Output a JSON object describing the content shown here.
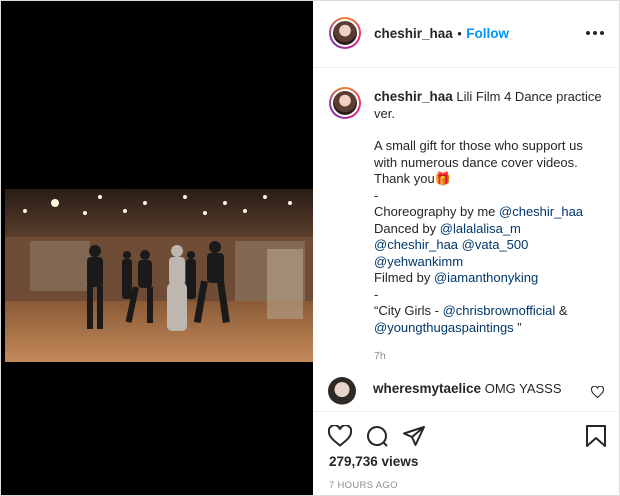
{
  "header": {
    "username": "cheshir_haa",
    "separator": "•",
    "follow_label": "Follow",
    "more_label": "•••"
  },
  "caption": {
    "username": "cheshir_haa",
    "title_line1": "Lili Film 4 Dance practice",
    "title_line2": "ver.",
    "p1_line1": "A small gift for those who support us",
    "p1_line2": "with numerous dance cover videos.",
    "p1_line3": "Thank you",
    "gift_emoji": "🎁",
    "dash1": "-",
    "choreo_prefix": "Choreography by me ",
    "choreo_link": "@cheshir_haa",
    "danced_prefix": "Danced by ",
    "danced_link1": "@lalalalisa_m",
    "danced_link2": "@cheshir_haa",
    "danced_link3": "@vata_500",
    "danced_link4": "@yehwankimm",
    "filmed_prefix": "Filmed by ",
    "filmed_link": "@iamanthonyking",
    "dash2": "-",
    "song_prefix": "“City Girls - ",
    "song_link1": "@chrisbrownofficial",
    "song_amp": " &",
    "song_link2": "@youngthugaspaintings",
    "song_suffix": " ”",
    "time": "7h"
  },
  "comment": {
    "username": "wheresmytaelice",
    "text": "OMG YASSS"
  },
  "footer": {
    "views": "279,736 views",
    "ago": "7 HOURS AGO"
  },
  "icons": {
    "like": "heart-icon",
    "comment": "comment-icon",
    "share": "share-icon",
    "save": "bookmark-icon",
    "more": "more-icon"
  }
}
